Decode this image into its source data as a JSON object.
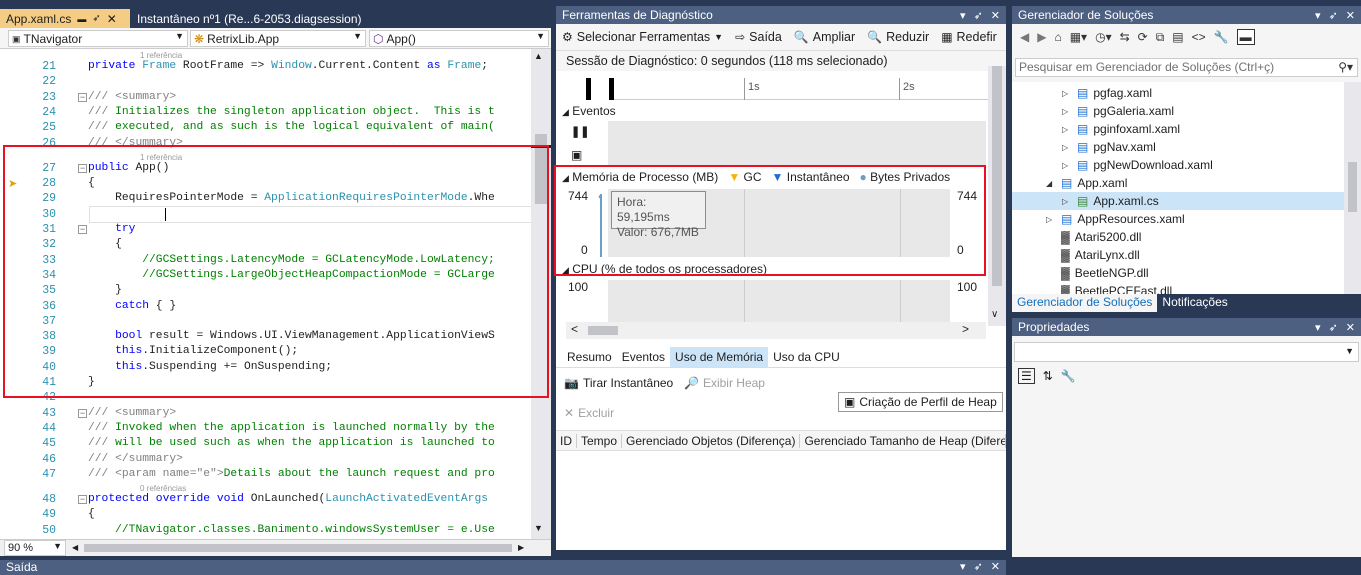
{
  "editor": {
    "tabs": [
      {
        "label": "App.xaml.cs",
        "active": true
      },
      {
        "label": "Instantâneo nº1 (Re...6-2053.diagsession)",
        "active": false
      }
    ],
    "nav": {
      "project": "TNavigator",
      "class": "RetrixLib.App",
      "member": "App()"
    },
    "zoom": "90 %",
    "lines": [
      {
        "n": "21",
        "ref": "1 referência",
        "code": "private Frame RootFrame => Window.Current.Content as Frame;"
      },
      {
        "n": "22",
        "code": ""
      },
      {
        "n": "23",
        "code": "/// <summary>"
      },
      {
        "n": "24",
        "code": "/// Initializes the singleton application object.  This is t"
      },
      {
        "n": "25",
        "code": "/// executed, and as such is the logical equivalent of main("
      },
      {
        "n": "26",
        "code": "/// </summary>"
      },
      {
        "n": "27",
        "ref": "1 referência",
        "code": "public App()"
      },
      {
        "n": "28",
        "code": "{"
      },
      {
        "n": "29",
        "code": "    RequiresPointerMode = ApplicationRequiresPointerMode.Whe"
      },
      {
        "n": "30",
        "code": ""
      },
      {
        "n": "31",
        "code": "    try"
      },
      {
        "n": "32",
        "code": "    {"
      },
      {
        "n": "33",
        "code": "        //GCSettings.LatencyMode = GCLatencyMode.LowLatency;"
      },
      {
        "n": "34",
        "code": "        //GCSettings.LargeObjectHeapCompactionMode = GCLarge"
      },
      {
        "n": "35",
        "code": "    }"
      },
      {
        "n": "36",
        "code": "    catch { }"
      },
      {
        "n": "37",
        "code": ""
      },
      {
        "n": "38",
        "code": "    bool result = Windows.UI.ViewManagement.ApplicationViewS"
      },
      {
        "n": "39",
        "code": "    this.InitializeComponent();"
      },
      {
        "n": "40",
        "code": "    this.Suspending += OnSuspending;"
      },
      {
        "n": "41",
        "code": "}"
      },
      {
        "n": "42",
        "code": ""
      },
      {
        "n": "43",
        "code": "/// <summary>"
      },
      {
        "n": "44",
        "code": "/// Invoked when the application is launched normally by the"
      },
      {
        "n": "45",
        "code": "/// will be used such as when the application is launched to"
      },
      {
        "n": "46",
        "code": "/// </summary>"
      },
      {
        "n": "47",
        "code": "/// <param name=\"e\">Details about the launch request and pro"
      },
      {
        "n": "48",
        "ref": "0 referências",
        "code": "protected override void OnLaunched(LaunchActivatedEventArgs"
      },
      {
        "n": "49",
        "code": "{"
      },
      {
        "n": "50",
        "code": "    //TNavigator.classes.Banimento.windowsSystemUser = e.Use"
      }
    ]
  },
  "diag": {
    "title": "Ferramentas de Diagnóstico",
    "toolbar": {
      "select_tools": "Selecionar Ferramentas",
      "exit": "Saída",
      "zoom_in": "Ampliar",
      "zoom_out": "Reduzir",
      "reset": "Redefir"
    },
    "session": "Sessão de Diagnóstico: 0 segundos (118 ms selecionado)",
    "ruler": {
      "t1": "1s",
      "t2": "2s"
    },
    "events_label": "Eventos",
    "memory": {
      "title": "Memória de Processo (MB)",
      "legend_gc": "GC",
      "legend_snapshot": "Instantâneo",
      "legend_private": "Bytes Privados",
      "ymax": "744",
      "ymin": "0",
      "tooltip_time": "Hora: 59,195ms",
      "tooltip_value": "Valor: 676,7MB"
    },
    "cpu": {
      "title": "CPU (% de todos os processadores)",
      "ymax": "100"
    },
    "tabs": [
      {
        "label": "Resumo",
        "selected": false
      },
      {
        "label": "Eventos",
        "selected": false
      },
      {
        "label": "Uso de Memória",
        "selected": true
      },
      {
        "label": "Uso da CPU",
        "selected": false
      }
    ],
    "mem_toolbar": {
      "snapshot": "Tirar Instantâneo",
      "show_heap": "Exibir Heap",
      "heap_profile": "Criação de Perfil de Heap",
      "delete": "Excluir"
    },
    "columns": [
      "ID",
      "Tempo",
      "Gerenciado Objetos (Diferença)",
      "Gerenciado Tamanho de Heap (Diferer"
    ]
  },
  "solution": {
    "title": "Gerenciador de Soluções",
    "search_placeholder": "Pesquisar em Gerenciador de Soluções (Ctrl+ç)",
    "items": [
      {
        "label": "pgfag.xaml",
        "indent": 1,
        "icon": "xaml"
      },
      {
        "label": "pgGaleria.xaml",
        "indent": 1,
        "icon": "xaml"
      },
      {
        "label": "pginfoxaml.xaml",
        "indent": 1,
        "icon": "xaml"
      },
      {
        "label": "pgNav.xaml",
        "indent": 1,
        "icon": "xaml"
      },
      {
        "label": "pgNewDownload.xaml",
        "indent": 1,
        "icon": "xaml"
      },
      {
        "label": "App.xaml",
        "indent": 0,
        "icon": "xaml",
        "expanded": true
      },
      {
        "label": "App.xaml.cs",
        "indent": 1,
        "icon": "cs",
        "selected": true
      },
      {
        "label": "AppResources.xaml",
        "indent": 0,
        "icon": "xaml"
      },
      {
        "label": "Atari5200.dll",
        "indent": 0,
        "icon": "dll"
      },
      {
        "label": "AtariLynx.dll",
        "indent": 0,
        "icon": "dll"
      },
      {
        "label": "BeetleNGP.dll",
        "indent": 0,
        "icon": "dll"
      },
      {
        "label": "BeetlePCEFast.dll",
        "indent": 0,
        "icon": "dll"
      }
    ],
    "tabs": [
      {
        "label": "Gerenciador de Soluções",
        "selected": true
      },
      {
        "label": "Notificações",
        "selected": false
      }
    ]
  },
  "properties": {
    "title": "Propriedades"
  },
  "output": {
    "title": "Saída"
  },
  "colors": {
    "accent_tab": "#f5cc84",
    "chrome": "#293955",
    "highlight_box": "#e81123",
    "selection": "#cce4f7"
  }
}
